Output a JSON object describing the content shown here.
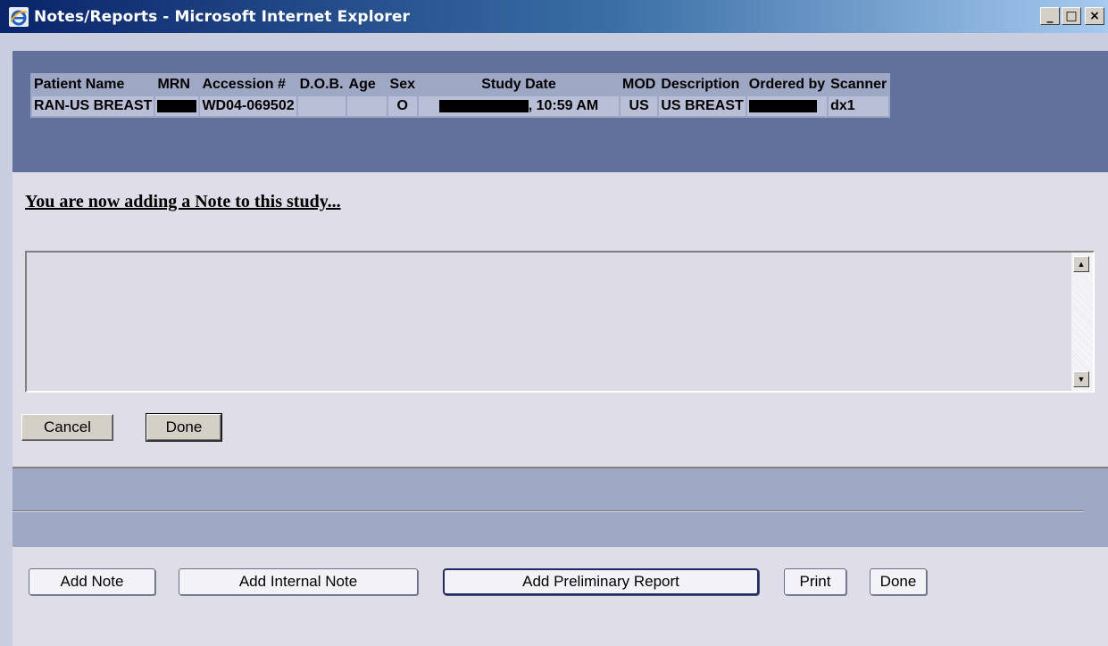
{
  "window": {
    "title": "Notes/Reports - Microsoft Internet Explorer",
    "app_icon": "ie-icon",
    "controls": {
      "minimize": "_",
      "maximize": "□",
      "close": "×"
    }
  },
  "study_table": {
    "columns": [
      "Patient Name",
      "MRN",
      "Accession #",
      "D.O.B.",
      "Age",
      "Sex",
      "Study Date",
      "MOD",
      "Description",
      "Ordered by",
      "Scanner"
    ],
    "row": {
      "patient_name": "RAN-US BREAST",
      "mrn": "[redacted]",
      "accession": "WD04-069502",
      "dob": "",
      "age": "",
      "sex": "O",
      "study_date_visible": ", 10:59 AM",
      "mod": "US",
      "description": "US BREAST",
      "ordered_by": "[redacted]",
      "scanner": "dx1"
    }
  },
  "note_editor": {
    "heading": "You are now adding a Note to this study...",
    "text_value": "",
    "cancel_label": "Cancel",
    "done_label": "Done"
  },
  "footer_buttons": {
    "add_note": "Add Note",
    "add_internal_note": "Add Internal Note",
    "add_preliminary_report": "Add Preliminary Report",
    "print": "Print",
    "done": "Done"
  }
}
